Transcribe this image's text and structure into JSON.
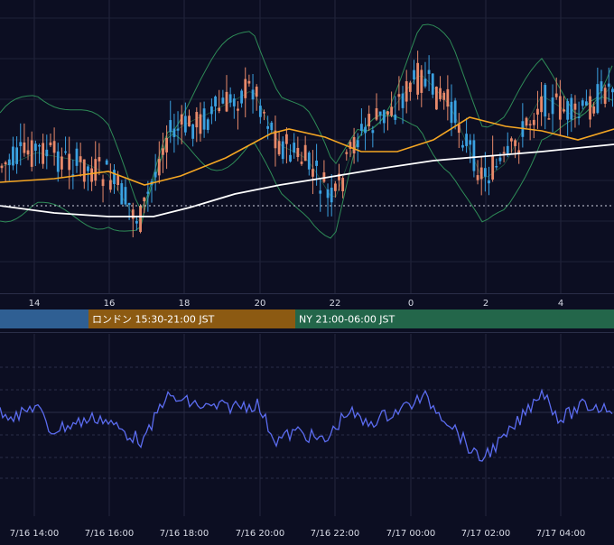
{
  "chart_data": [
    {
      "type": "candlestick",
      "panel": "price",
      "x_tick_labels": [
        "14",
        "16",
        "18",
        "20",
        "22",
        "0",
        "2",
        "4"
      ],
      "overlays": [
        {
          "indicator": "bollinger-bands",
          "color": "#2e8b57"
        },
        {
          "indicator": "moving-average-fast",
          "color": "#f5a623"
        },
        {
          "indicator": "moving-average-slow",
          "color": "#ffffff"
        }
      ],
      "candle_colors": {
        "up": "#3aa0e0",
        "down": "#e8896a"
      },
      "grid": true
    },
    {
      "type": "line",
      "panel": "oscillator",
      "series_color": "#5b6cf0",
      "x_tick_labels": [
        "7/16 14:00",
        "7/16 16:00",
        "7/16 18:00",
        "7/16 20:00",
        "7/16 22:00",
        "7/17 00:00",
        "7/17 02:00",
        "7/17 04:00"
      ],
      "grid": true
    }
  ],
  "sessions": [
    {
      "label": "",
      "color": "#2f5f93"
    },
    {
      "label": "ロンドン 15:30-21:00 JST",
      "color": "#8c5a12"
    },
    {
      "label": "NY 21:00-06:00 JST",
      "color": "#23664a"
    }
  ]
}
